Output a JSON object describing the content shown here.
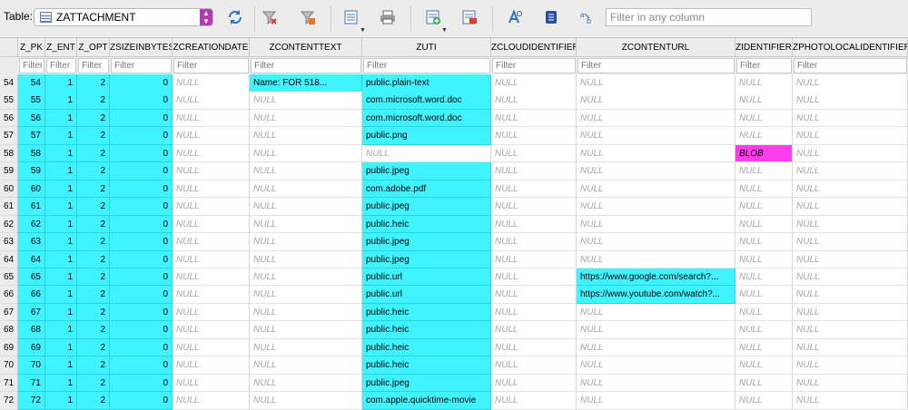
{
  "toolbar": {
    "table_label": "Table:",
    "table_name": "ZATTACHMENT",
    "filter_placeholder": "Filter in any column",
    "icons": [
      "refresh-icon",
      "clear-filters-icon",
      "save-filters-icon",
      "print-icon-1",
      "print-icon-2",
      "insert-record-icon",
      "delete-record-icon",
      "find-icon",
      "find-replace-icon",
      "goto-icon"
    ]
  },
  "grid": {
    "columns": [
      "Z_PK",
      "Z_ENT",
      "Z_OPT",
      "ZSIZEINBYTES",
      "ZCREATIONDATE",
      "ZCONTENTTEXT",
      "ZUTI",
      "ZCLOUDIDENTIFIER",
      "ZCONTENTURL",
      "ZIDENTIFIER",
      "ZPHOTOLOCALIDENTIFIER"
    ],
    "filter_placeholder": "Filter",
    "null_text": "NULL",
    "rows": [
      {
        "n": "54",
        "pk": "54",
        "ent": "1",
        "opt": "2",
        "size": "0",
        "text": "Name: FOR 518...",
        "uti": "public.plain-text",
        "url": "",
        "id": ""
      },
      {
        "n": "55",
        "pk": "55",
        "ent": "1",
        "opt": "2",
        "size": "0",
        "text": "",
        "uti": "com.microsoft.word.doc",
        "url": "",
        "id": ""
      },
      {
        "n": "56",
        "pk": "56",
        "ent": "1",
        "opt": "2",
        "size": "0",
        "text": "",
        "uti": "com.microsoft.word.doc",
        "url": "",
        "id": ""
      },
      {
        "n": "57",
        "pk": "57",
        "ent": "1",
        "opt": "2",
        "size": "0",
        "text": "",
        "uti": "public.png",
        "url": "",
        "id": ""
      },
      {
        "n": "58",
        "pk": "58",
        "ent": "1",
        "opt": "2",
        "size": "0",
        "text": "",
        "uti": "",
        "url": "",
        "id": "BLOB"
      },
      {
        "n": "59",
        "pk": "59",
        "ent": "1",
        "opt": "2",
        "size": "0",
        "text": "",
        "uti": "public.jpeg",
        "url": "",
        "id": ""
      },
      {
        "n": "60",
        "pk": "60",
        "ent": "1",
        "opt": "2",
        "size": "0",
        "text": "",
        "uti": "com.adobe.pdf",
        "url": "",
        "id": ""
      },
      {
        "n": "61",
        "pk": "61",
        "ent": "1",
        "opt": "2",
        "size": "0",
        "text": "",
        "uti": "public.jpeg",
        "url": "",
        "id": ""
      },
      {
        "n": "62",
        "pk": "62",
        "ent": "1",
        "opt": "2",
        "size": "0",
        "text": "",
        "uti": "public.heic",
        "url": "",
        "id": ""
      },
      {
        "n": "63",
        "pk": "63",
        "ent": "1",
        "opt": "2",
        "size": "0",
        "text": "",
        "uti": "public.jpeg",
        "url": "",
        "id": ""
      },
      {
        "n": "64",
        "pk": "64",
        "ent": "1",
        "opt": "2",
        "size": "0",
        "text": "",
        "uti": "public.jpeg",
        "url": "",
        "id": ""
      },
      {
        "n": "65",
        "pk": "65",
        "ent": "1",
        "opt": "2",
        "size": "0",
        "text": "",
        "uti": "public.url",
        "url": "https://www.google.com/search?...",
        "id": ""
      },
      {
        "n": "66",
        "pk": "66",
        "ent": "1",
        "opt": "2",
        "size": "0",
        "text": "",
        "uti": "public.url",
        "url": "https://www.youtube.com/watch?...",
        "id": ""
      },
      {
        "n": "67",
        "pk": "67",
        "ent": "1",
        "opt": "2",
        "size": "0",
        "text": "",
        "uti": "public.heic",
        "url": "",
        "id": ""
      },
      {
        "n": "68",
        "pk": "68",
        "ent": "1",
        "opt": "2",
        "size": "0",
        "text": "",
        "uti": "public.heic",
        "url": "",
        "id": ""
      },
      {
        "n": "69",
        "pk": "69",
        "ent": "1",
        "opt": "2",
        "size": "0",
        "text": "",
        "uti": "public.heic",
        "url": "",
        "id": ""
      },
      {
        "n": "70",
        "pk": "70",
        "ent": "1",
        "opt": "2",
        "size": "0",
        "text": "",
        "uti": "public.heic",
        "url": "",
        "id": ""
      },
      {
        "n": "71",
        "pk": "71",
        "ent": "1",
        "opt": "2",
        "size": "0",
        "text": "",
        "uti": "public.jpeg",
        "url": "",
        "id": ""
      },
      {
        "n": "72",
        "pk": "72",
        "ent": "1",
        "opt": "2",
        "size": "0",
        "text": "",
        "uti": "com.apple.quicktime-movie",
        "url": "",
        "id": ""
      }
    ]
  },
  "colors": {
    "highlight": "#3ff3ff",
    "blob": "#ff3ded",
    "null_text": "#a5a5a5"
  }
}
